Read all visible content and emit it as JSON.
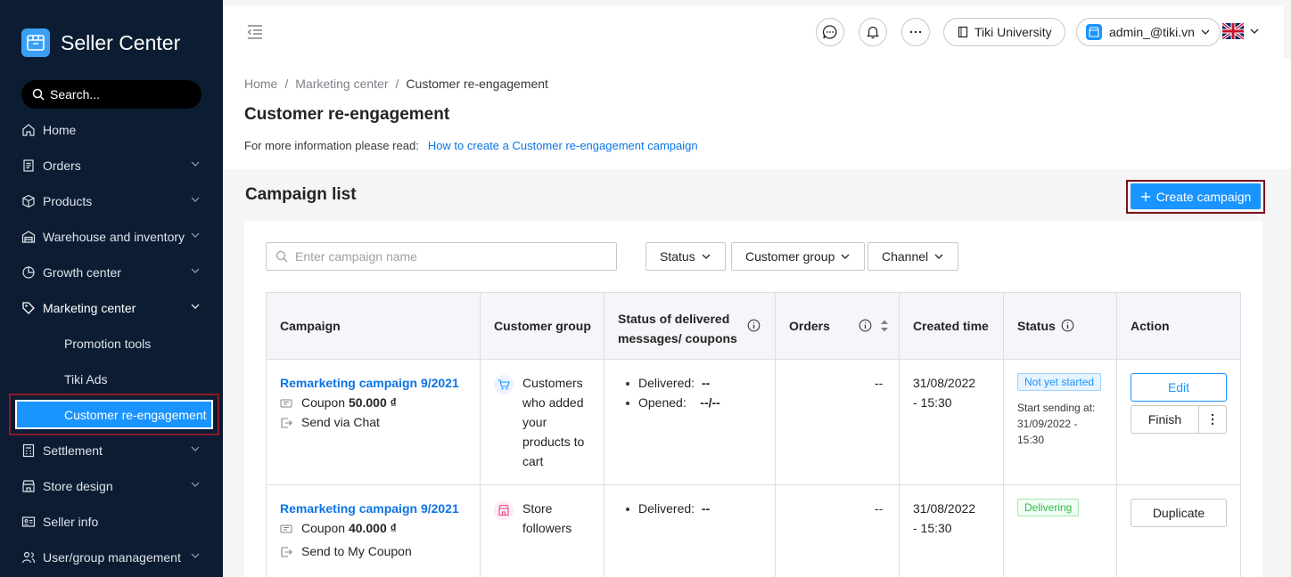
{
  "sidebar": {
    "brand": "Seller Center",
    "search_placeholder": "Search...",
    "items": [
      {
        "label": "Home"
      },
      {
        "label": "Orders"
      },
      {
        "label": "Products"
      },
      {
        "label": "Warehouse and inventory"
      },
      {
        "label": "Growth center"
      },
      {
        "label": "Marketing center"
      },
      {
        "label": "Promotion tools"
      },
      {
        "label": "Tiki Ads"
      },
      {
        "label": "Customer re-engagement"
      },
      {
        "label": "Settlement"
      },
      {
        "label": "Store design"
      },
      {
        "label": "Seller info"
      },
      {
        "label": "User/group management"
      }
    ]
  },
  "header": {
    "university": "Tiki University",
    "account": "admin_@tiki.vn"
  },
  "breadcrumb": {
    "home": "Home",
    "marketing": "Marketing center",
    "current": "Customer re-engagement",
    "sep": "/"
  },
  "page": {
    "title": "Customer re-engagement",
    "info_prefix": "For more information please read:",
    "info_link": "How to create a Customer re-engagement campaign",
    "section_title": "Campaign list",
    "create_button": "Create campaign",
    "search_placeholder": "Enter campaign name",
    "filters": [
      "Status",
      "Customer group",
      "Channel"
    ]
  },
  "table": {
    "headers": {
      "campaign": "Campaign",
      "customer_group": "Customer group",
      "delivered_line1": "Status of delivered",
      "delivered_line2": "messages/ coupons",
      "orders": "Orders",
      "created": "Created time",
      "status": "Status",
      "action": "Action"
    },
    "rows": [
      {
        "name": "Remarketing campaign 9/2021",
        "coupon_label": "Coupon",
        "coupon_value": "50.000 ₫",
        "channel": "Send via Chat",
        "group_lines": [
          "Customers",
          "who added",
          "your",
          "products to",
          "cart"
        ],
        "delivered_label": "Delivered:",
        "delivered_value": "--",
        "opened_label": "Opened:",
        "opened_value": "--/--",
        "orders": "--",
        "created_1": "31/08/2022",
        "created_2": "- 15:30",
        "status": "Not yet started",
        "start_1": "Start sending at:",
        "start_2": "31/09/2022 -",
        "start_3": "15:30",
        "action_primary": "Edit",
        "action_secondary": "Finish"
      },
      {
        "name": "Remarketing campaign 9/2021",
        "coupon_label": "Coupon",
        "coupon_value": "40.000 ₫",
        "channel": "Send to My Coupon",
        "group_lines": [
          "Store",
          "followers"
        ],
        "delivered_label": "Delivered:",
        "delivered_value": "--",
        "orders": "--",
        "created_1": "31/08/2022",
        "created_2": "- 15:30",
        "status": "Delivering",
        "action_primary": "Duplicate"
      }
    ]
  },
  "icons": {
    "accent": "#1a94ff",
    "sidebar_bg": "#0c1d33",
    "highlight_border": "#8a1a2a"
  }
}
